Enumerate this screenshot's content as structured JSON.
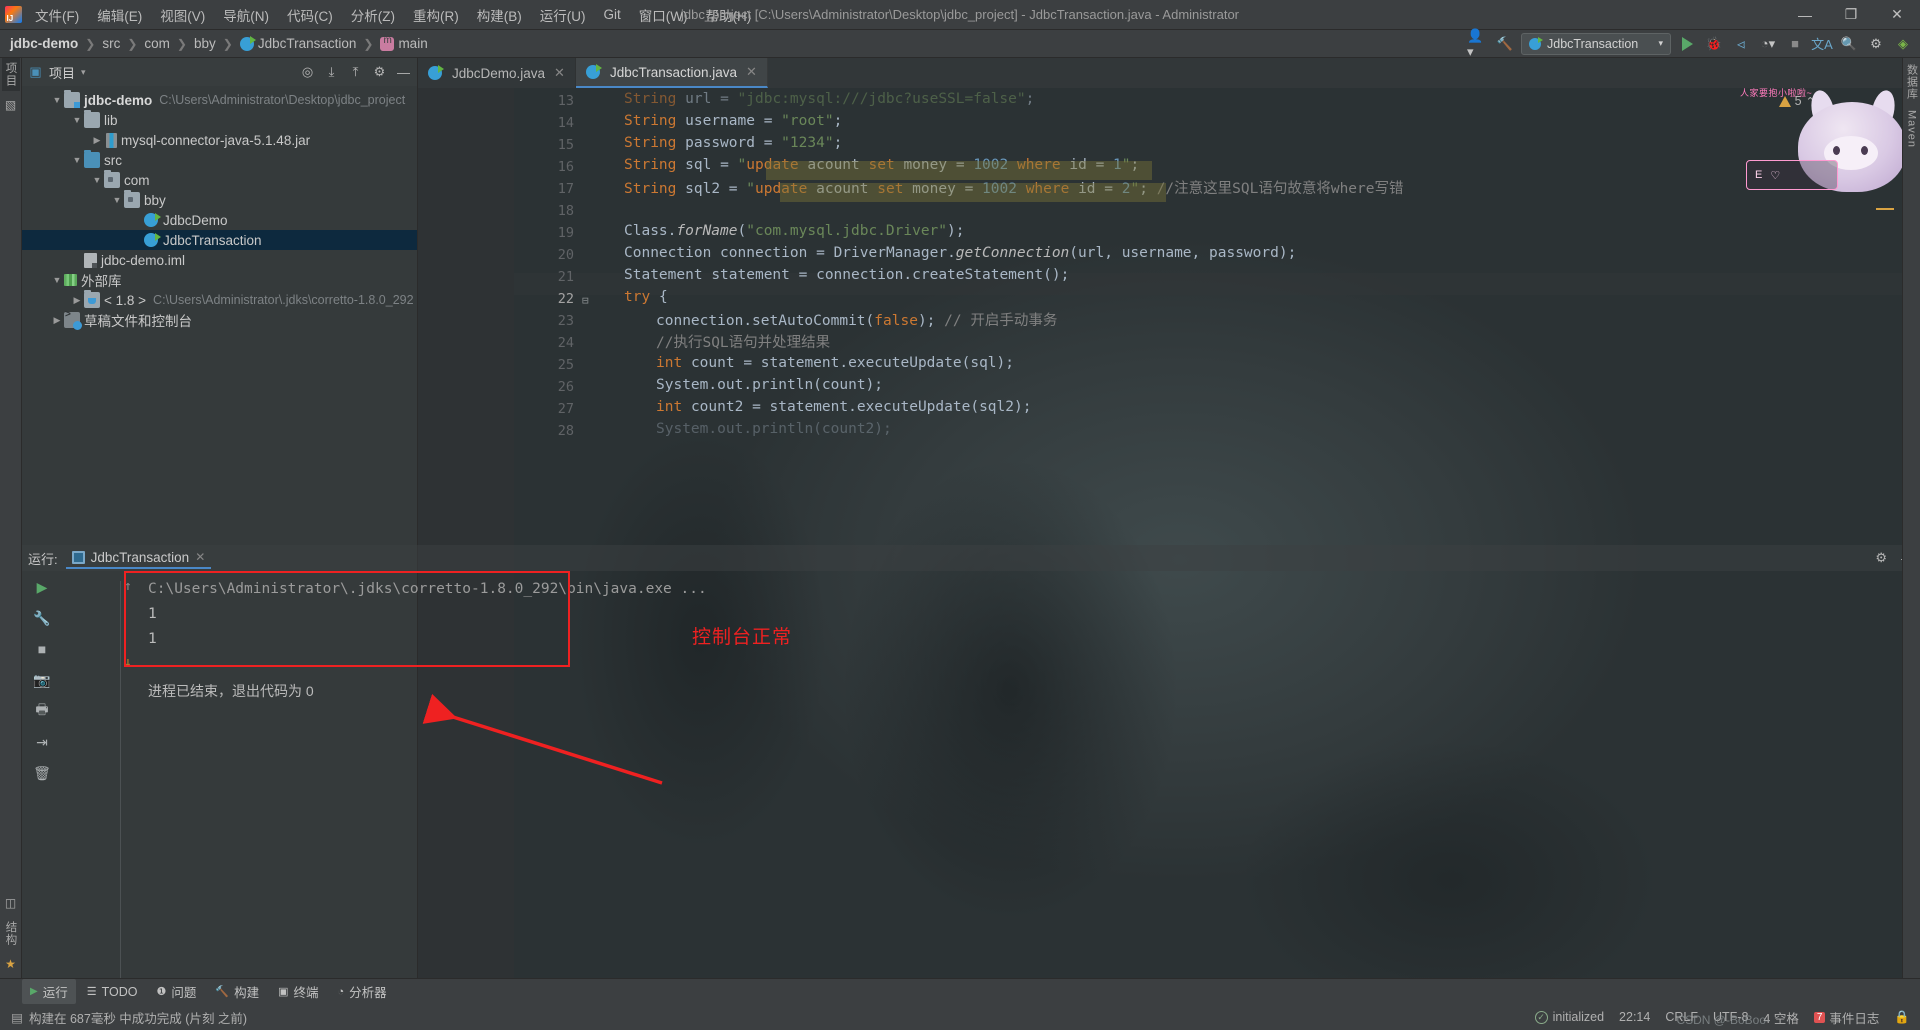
{
  "window": {
    "title": "jdbc_project [C:\\Users\\Administrator\\Desktop\\jdbc_project] - JdbcTransaction.java - Administrator",
    "minimize": "—",
    "maximize": "❐",
    "close": "✕"
  },
  "menu": [
    {
      "label": "文件(F)"
    },
    {
      "label": "编辑(E)"
    },
    {
      "label": "视图(V)"
    },
    {
      "label": "导航(N)"
    },
    {
      "label": "代码(C)"
    },
    {
      "label": "分析(Z)"
    },
    {
      "label": "重构(R)"
    },
    {
      "label": "构建(B)"
    },
    {
      "label": "运行(U)"
    },
    {
      "label": "Git"
    },
    {
      "label": "窗口(W)"
    },
    {
      "label": "帮助(H)"
    }
  ],
  "breadcrumb": [
    {
      "label": "jdbc-demo",
      "icon": "none"
    },
    {
      "label": "src",
      "icon": "none"
    },
    {
      "label": "com",
      "icon": "none"
    },
    {
      "label": "bby",
      "icon": "none"
    },
    {
      "label": "JdbcTransaction",
      "icon": "class-icon"
    },
    {
      "label": "main",
      "icon": "method-icon"
    }
  ],
  "toolbar": {
    "run_config": "JdbcTransaction",
    "run_label": "运行",
    "debug_label": "调试",
    "profile_label": "性能分析",
    "coverage_label": "覆盖率",
    "stop_label": "停止",
    "search_label": "搜索",
    "settings_label": "设置",
    "translate_label": "翻译"
  },
  "project_panel": {
    "title": "项目",
    "icons": [
      "target-icon",
      "collapse-icon",
      "expand-icon",
      "gear-icon",
      "minimize-icon"
    ],
    "tree": [
      {
        "label": "jdbc-demo",
        "path": "C:\\Users\\Administrator\\Desktop\\jdbc_project",
        "indent": 0,
        "arrow": "▾",
        "icon": "module-folder-icon",
        "bold": true,
        "selected": false
      },
      {
        "label": "lib",
        "path": "",
        "indent": 1,
        "arrow": "▾",
        "icon": "folder-icon",
        "bold": false,
        "selected": false
      },
      {
        "label": "mysql-connector-java-5.1.48.jar",
        "path": "",
        "indent": 2,
        "arrow": "›",
        "icon": "jar-icon",
        "bold": false,
        "selected": false
      },
      {
        "label": "src",
        "path": "",
        "indent": 1,
        "arrow": "▾",
        "icon": "source-folder-icon",
        "bold": false,
        "selected": false
      },
      {
        "label": "com",
        "path": "",
        "indent": 2,
        "arrow": "▾",
        "icon": "package-icon",
        "bold": false,
        "selected": false
      },
      {
        "label": "bby",
        "path": "",
        "indent": 3,
        "arrow": "▾",
        "icon": "package-icon",
        "bold": false,
        "selected": false
      },
      {
        "label": "JdbcDemo",
        "path": "",
        "indent": 4,
        "arrow": "",
        "icon": "java-class-icon",
        "bold": false,
        "selected": false
      },
      {
        "label": "JdbcTransaction",
        "path": "",
        "indent": 4,
        "arrow": "",
        "icon": "java-class-icon",
        "bold": false,
        "selected": true
      },
      {
        "label": "jdbc-demo.iml",
        "path": "",
        "indent": 1,
        "arrow": "",
        "icon": "iml-file-icon",
        "bold": false,
        "selected": false
      },
      {
        "label": "外部库",
        "path": "",
        "indent": 0,
        "arrow": "▾",
        "icon": "library-icon",
        "bold": false,
        "selected": false
      },
      {
        "label": "< 1.8 >",
        "path": "C:\\Users\\Administrator\\.jdks\\corretto-1.8.0_292",
        "indent": 1,
        "arrow": "›",
        "icon": "jdk-icon",
        "bold": false,
        "selected": false
      },
      {
        "label": "草稿文件和控制台",
        "path": "",
        "indent": 0,
        "arrow": "›",
        "icon": "scratch-icon",
        "bold": false,
        "selected": false
      }
    ]
  },
  "editor": {
    "tabs": [
      {
        "label": "JdbcDemo.java",
        "active": false
      },
      {
        "label": "JdbcTransaction.java",
        "active": true
      }
    ],
    "warning_count": "5",
    "first_line_number": 13,
    "current_line": 22,
    "lines": [
      {
        "n": 13,
        "text": "String url = \"jdbc:mysql:///jdbc?useSSL=false\";",
        "clipped": true
      },
      {
        "n": 14,
        "text": "String username = \"root\";"
      },
      {
        "n": 15,
        "text": "String password = \"1234\";"
      },
      {
        "n": 16,
        "text": "String sql = \"update acount set money = 1002 where id = 1\";"
      },
      {
        "n": 17,
        "text": "String sql2 = \"update acount set money = 1002 where id = 2\"; //注意这里SQL语句故意将where写错"
      },
      {
        "n": 18,
        "text": ""
      },
      {
        "n": 19,
        "text": "Class.forName(\"com.mysql.jdbc.Driver\");"
      },
      {
        "n": 20,
        "text": "Connection connection = DriverManager.getConnection(url, username, password);"
      },
      {
        "n": 21,
        "text": "Statement statement = connection.createStatement();"
      },
      {
        "n": 22,
        "text": "try {"
      },
      {
        "n": 23,
        "text": "connection.setAutoCommit(false); // 开启手动事务"
      },
      {
        "n": 24,
        "text": "//执行SQL语句并处理结果"
      },
      {
        "n": 25,
        "text": "int count = statement.executeUpdate(sql);"
      },
      {
        "n": 26,
        "text": "System.out.println(count);"
      },
      {
        "n": 27,
        "text": "int count2 = statement.executeUpdate(sql2);"
      },
      {
        "n": 28,
        "text": "System.out.println(count2);"
      }
    ]
  },
  "run_panel": {
    "header_label": "运行:",
    "tab_label": "JdbcTransaction",
    "close_icon": "✕",
    "tools": [
      "rerun-icon",
      "wrench-icon",
      "stop-icon",
      "camera-icon",
      "print-icon",
      "export-icon",
      "trash-icon"
    ],
    "console": [
      "C:\\Users\\Administrator\\.jdks\\corretto-1.8.0_292\\bin\\java.exe ...",
      "1",
      "1",
      "",
      "进程已结束，退出代码为 0"
    ],
    "annotation": "控制台正常",
    "annotation_color": "#ef2121",
    "settings_icon": "gear-icon",
    "minimize_icon": "minimize-icon"
  },
  "left_strip": {
    "tabs": [
      "项目",
      "收藏夹"
    ],
    "bottom_tabs": [
      "结构",
      "书签"
    ]
  },
  "right_strip": {
    "tabs": [
      "数据库",
      "Maven"
    ]
  },
  "bottom_toolbar": [
    {
      "label": "运行",
      "icon": "run-icon",
      "active": true
    },
    {
      "label": "TODO",
      "icon": "todo-icon",
      "active": false
    },
    {
      "label": "问题",
      "icon": "problems-icon",
      "active": false
    },
    {
      "label": "构建",
      "icon": "build-icon",
      "active": false
    },
    {
      "label": "终端",
      "icon": "terminal-icon",
      "active": false
    },
    {
      "label": "分析器",
      "icon": "profiler-icon",
      "active": false
    }
  ],
  "status_bar": {
    "message": "构建在 687毫秒 中成功完成 (片刻 之前)",
    "git_branch": "initialized",
    "position": "22:14",
    "line_separator": "CRLF",
    "encoding": "UTF-8",
    "indent": "4 空格",
    "event_log": "事件日志",
    "event_badge": "7",
    "lock_icon": "lock-icon"
  },
  "mascot": {
    "caption": "人家要抱小啦啦~",
    "board_icons": [
      "E",
      "♡"
    ]
  },
  "watermark": "CSDN @-BoBoo-"
}
